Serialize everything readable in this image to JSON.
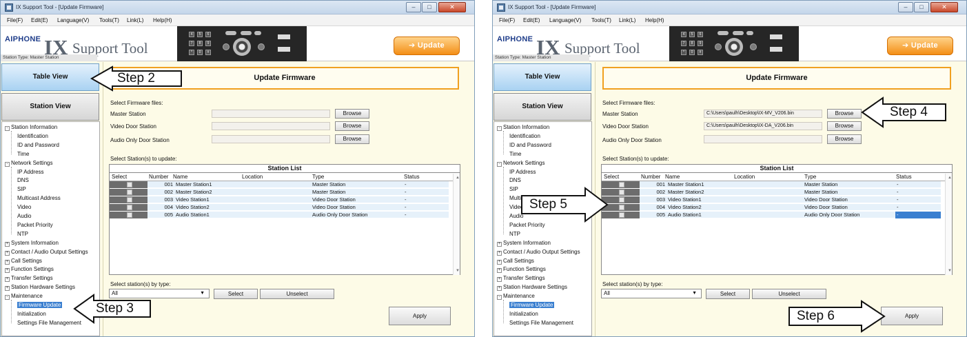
{
  "app": {
    "title": "IX Support Tool - [Update Firmware]",
    "menu": [
      "File(F)",
      "Edit(E)",
      "Language(V)",
      "Tools(T)",
      "Link(L)",
      "Help(H)"
    ],
    "brand": "AIPHONE",
    "logo_big": "IX",
    "logo_rest": "Support Tool",
    "station_type": "Station Type:  Master Station",
    "update_label": "Update",
    "keypad": [
      "4",
      "5",
      "6",
      "7",
      "8",
      "9",
      "*",
      "0",
      "#"
    ]
  },
  "sidebar": {
    "table_view": "Table View",
    "station_view": "Station View",
    "tree": [
      {
        "label": "Station Information",
        "level": 0,
        "exp": "-"
      },
      {
        "label": "Identification",
        "level": 1
      },
      {
        "label": "ID and Password",
        "level": 1
      },
      {
        "label": "Time",
        "level": 1
      },
      {
        "label": "Network Settings",
        "level": 0,
        "exp": "-"
      },
      {
        "label": "IP Address",
        "level": 1
      },
      {
        "label": "DNS",
        "level": 1
      },
      {
        "label": "SIP",
        "level": 1
      },
      {
        "label": "Multicast Address",
        "level": 1
      },
      {
        "label": "Video",
        "level": 1
      },
      {
        "label": "Audio",
        "level": 1
      },
      {
        "label": "Packet Priority",
        "level": 1
      },
      {
        "label": "NTP",
        "level": 1
      },
      {
        "label": "System Information",
        "level": 0,
        "exp": "+"
      },
      {
        "label": "Contact / Audio Output Settings",
        "level": 0,
        "exp": "+"
      },
      {
        "label": "Call Settings",
        "level": 0,
        "exp": "+"
      },
      {
        "label": "Function Settings",
        "level": 0,
        "exp": "+"
      },
      {
        "label": "Transfer Settings",
        "level": 0,
        "exp": "+"
      },
      {
        "label": "Station Hardware Settings",
        "level": 0,
        "exp": "+"
      },
      {
        "label": "Maintenance",
        "level": 0,
        "exp": "-"
      },
      {
        "label": "Firmware Update",
        "level": 1,
        "selected": true
      },
      {
        "label": "Initialization",
        "level": 1
      },
      {
        "label": "Settings File Management",
        "level": 1
      }
    ]
  },
  "main": {
    "header": "Update Firmware",
    "select_files_label": "Select Firmware files:",
    "file_rows": [
      {
        "label": "Master Station"
      },
      {
        "label": "Video Door Station"
      },
      {
        "label": "Audio Only Door Station"
      }
    ],
    "browse_label": "Browse",
    "select_stations_label": "Select Station(s) to update:",
    "station_list_title": "Station List",
    "columns": [
      "Select",
      "Number",
      "Name",
      "Location",
      "Type",
      "Status"
    ],
    "stations": [
      {
        "number": "001",
        "name": "Master Station1",
        "location": "",
        "type": "Master Station",
        "status": "-"
      },
      {
        "number": "002",
        "name": "Master Station2",
        "location": "",
        "type": "Master Station",
        "status": "-"
      },
      {
        "number": "003",
        "name": "Video Station1",
        "location": "",
        "type": "Video Door Station",
        "status": "-"
      },
      {
        "number": "004",
        "name": "Video Station2",
        "location": "",
        "type": "Video Door Station",
        "status": "-"
      },
      {
        "number": "005",
        "name": "Audio Station1",
        "location": "",
        "type": "Audio Only Door Station",
        "status": "-"
      }
    ],
    "select_by_type_label": "Select station(s) by type:",
    "type_value": "All",
    "select_button": "Select",
    "unselect_button": "Unselect",
    "apply_button": "Apply"
  },
  "windows": [
    {
      "file_values": [
        "",
        "",
        ""
      ],
      "highlight_last_status": false
    },
    {
      "file_values": [
        "C:\\Users\\paulh\\Desktop\\IX-MV_V206.bin",
        "C:\\Users\\paulh\\Desktop\\IX-DA_V206.bin",
        ""
      ],
      "highlight_last_status": true
    }
  ],
  "callouts": {
    "step2": "Step 2",
    "step3": "Step 3",
    "step4": "Step 4",
    "step5": "Step 5",
    "step6": "Step 6"
  }
}
